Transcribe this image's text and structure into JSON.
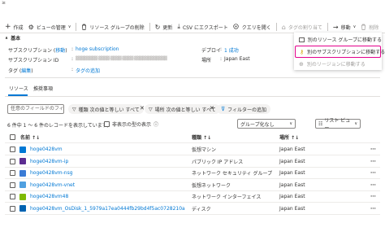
{
  "topbar": {
    "corner_glyph": "≥"
  },
  "toolbar": {
    "create": "作成",
    "manage_view": "ビューの管理",
    "delete_rg": "リソース グループの削除",
    "refresh": "更新",
    "export_csv": "CSV にエクスポート",
    "open_query": "クエリを開く",
    "assign_tags": "タグの割り当て",
    "move": "移動",
    "delete": "削除"
  },
  "essentials": {
    "header": "基本",
    "subscription_label": "サブスクリプション (移動)",
    "subscription_value": "hoge subscription",
    "subscription_id_label": "サブスクリプション ID",
    "subscription_id_value": "▓▓▓▓▓▓▓▓-▓▓▓▓-▓▓▓▓-▓▓▓▓-▓▓▓▓▓▓▓▓▓▓▓▓",
    "tags_label": "タグ (編集)",
    "tags_value": "タグの追加",
    "deploy_label": "デプロイ",
    "deploy_value": "1 成功",
    "location_label": "場所",
    "location_value": "Japan East"
  },
  "move_menu": {
    "items": [
      "別のリソース グループに移動する",
      "別のサブスクリプションに移動する",
      "別のリージョンに移動する"
    ]
  },
  "tabs": [
    "リソース",
    "推奨事項"
  ],
  "filters": {
    "search_placeholder": "任意のフィールドのフィ...",
    "type_filter": "種類 次の値と等しい すべて",
    "location_filter": "場所 次の値と等しい すべて",
    "add_filter": "フィルターの追加"
  },
  "records": {
    "summary": "6 件中 1 ～ 6 件のレコードを表示しています。",
    "hidden_types": "非表示の型の表示",
    "grouping": "グループ化なし",
    "view": "リスト ビュー"
  },
  "table": {
    "headers": [
      "名前 ↑↓",
      "種類 ↑↓",
      "場所 ↑↓"
    ],
    "rows": [
      {
        "name": "hoge0428vm",
        "type": "仮想マシン",
        "location": "Japan East",
        "icon_color": "#0078d4"
      },
      {
        "name": "hoge0428vm-ip",
        "type": "パブリック IP アドレス",
        "location": "Japan East",
        "icon_color": "#5c2d91"
      },
      {
        "name": "hoge0428vm-nsg",
        "type": "ネットワーク セキュリティ グループ",
        "location": "Japan East",
        "icon_color": "#3a7bd5"
      },
      {
        "name": "hoge0428vm-vnet",
        "type": "仮想ネットワーク",
        "location": "Japan East",
        "icon_color": "#50a0e0"
      },
      {
        "name": "hoge0428vm48",
        "type": "ネットワーク インターフェイス",
        "location": "Japan East",
        "icon_color": "#7fba00"
      },
      {
        "name": "hoge0428vm_OsDisk_1_5979a17ea0444fb29bd4f5ac0728210a",
        "type": "ディスク",
        "location": "Japan East",
        "icon_color": "#0063b1"
      }
    ]
  },
  "colors": {
    "accent": "#0078d4",
    "highlight": "#e3008c"
  }
}
